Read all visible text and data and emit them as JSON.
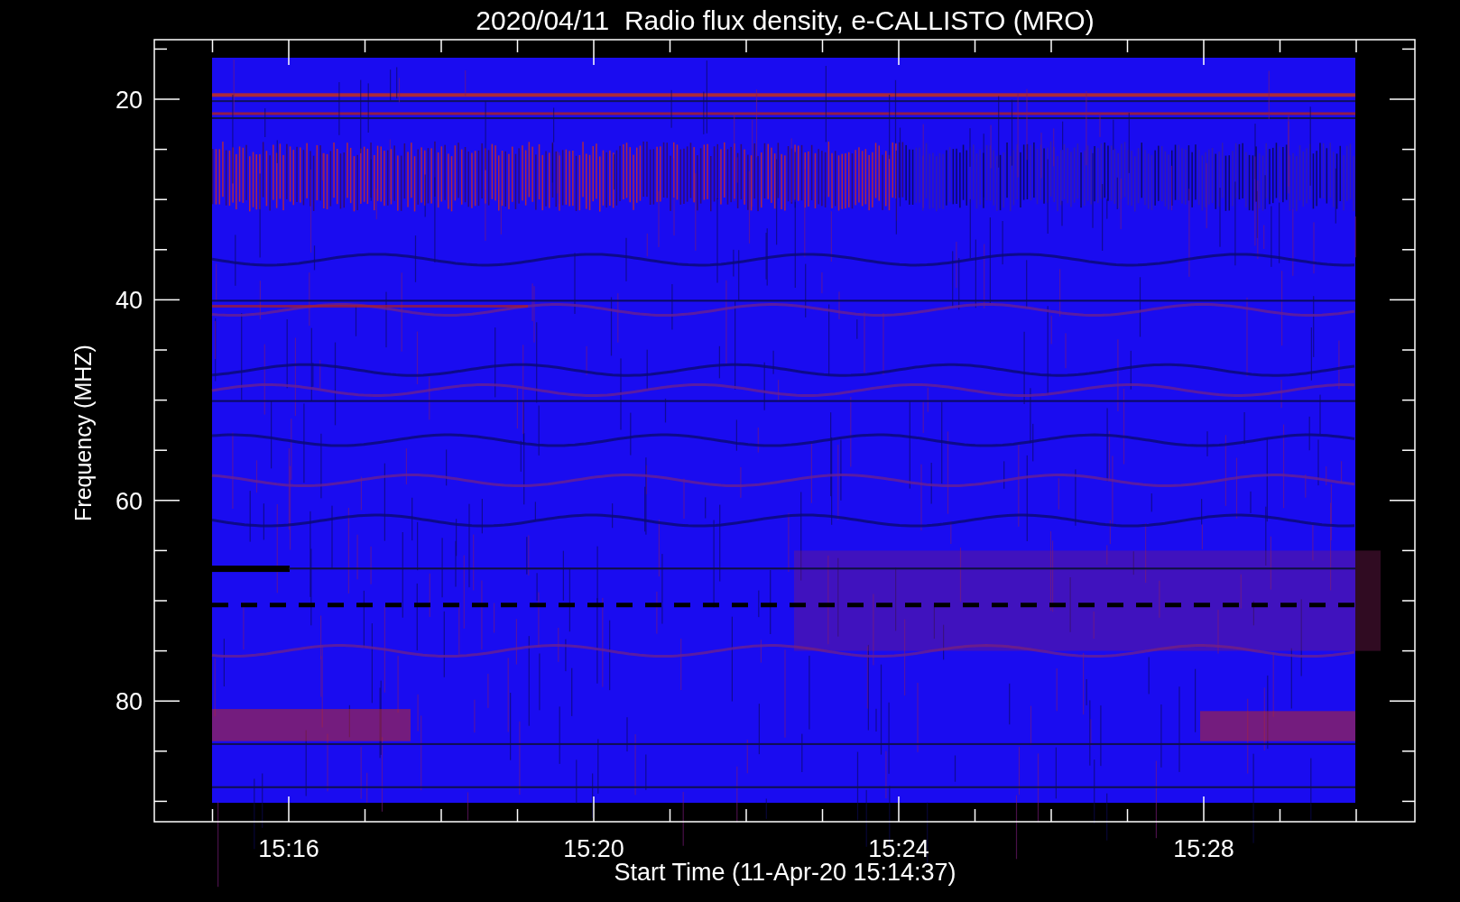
{
  "title": "2020/04/11  Radio flux density, e-CALLISTO (MRO)",
  "y_axis": {
    "title": "Frequency (MHZ)",
    "tick_labels": [
      "20",
      "40",
      "60",
      "80"
    ]
  },
  "x_axis": {
    "title": "Start Time (11-Apr-20 15:14:37)",
    "tick_labels": [
      "15:16",
      "15:20",
      "15:24",
      "15:28"
    ]
  }
}
